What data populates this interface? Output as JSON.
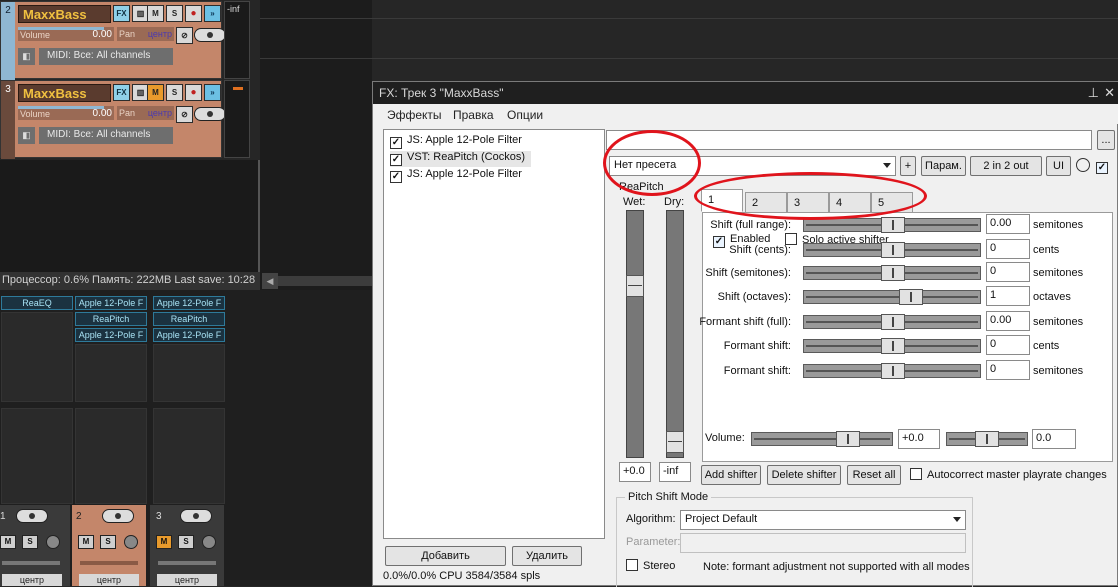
{
  "tracks": [
    {
      "num": "2",
      "name": "MaxxBass",
      "volume_label": "Volume",
      "volume_value": "0.00",
      "pan_label": "Pan",
      "pan_value": "центр",
      "midi": "MIDI: Все: All channels",
      "meter": "-inf",
      "fx": "FX",
      "m": "M",
      "s": "S"
    },
    {
      "num": "3",
      "name": "MaxxBass",
      "volume_label": "Volume",
      "volume_value": "0.00",
      "pan_label": "Pan",
      "pan_value": "центр",
      "midi": "MIDI: Все: All channels",
      "meter": "",
      "fx": "FX",
      "m": "M",
      "s": "S"
    }
  ],
  "status": {
    "text": "Процессор: 0.6%  Память: 222MB  Last save: 10:28"
  },
  "mixer": {
    "columns": [
      {
        "fx": [
          "ReaEQ"
        ],
        "num": "1",
        "pan": "центр"
      },
      {
        "fx": [
          "Apple 12-Pole F",
          "ReaPitch",
          "Apple 12-Pole F"
        ],
        "num": "2",
        "pan": "центр"
      },
      {
        "fx": [
          "Apple 12-Pole F",
          "ReaPitch",
          "Apple 12-Pole F"
        ],
        "num": "3",
        "pan": "центр"
      }
    ],
    "m": "M",
    "s": "S"
  },
  "fxwindow": {
    "title": "FX: Трек 3 \"MaxxBass\"",
    "menu": [
      "Эффекты",
      "Правка",
      "Опции"
    ],
    "chain": [
      {
        "label": "JS: Apple 12-Pole Filter",
        "checked": true
      },
      {
        "label": "VST: ReaPitch (Cockos)",
        "checked": true
      },
      {
        "label": "JS: Apple 12-Pole Filter",
        "checked": true
      }
    ],
    "add_button": "Добавить",
    "remove_button": "Удалить",
    "cpu": "0.0%/0.0% CPU 3584/3584 spls",
    "browse_button": "...",
    "preset": "Нет пресета",
    "plus_button": "+",
    "param_button": "Парам.",
    "io_button": "2 in 2 out",
    "ui_button": "UI",
    "plugin_name": "ReaPitch",
    "wet_label": "Wet:",
    "dry_label": "Dry:",
    "wet_value": "+0.0",
    "dry_value": "-inf",
    "tabs": [
      "1",
      "2",
      "3",
      "4",
      "5"
    ],
    "enabled_label": "Enabled",
    "solo_label": "Solo active shifter",
    "params": [
      {
        "label": "Shift (full range):",
        "value": "0.00",
        "unit": "semitones",
        "pos": 0.5
      },
      {
        "label": "Shift (cents):",
        "value": "0",
        "unit": "cents",
        "pos": 0.5
      },
      {
        "label": "Shift (semitones):",
        "value": "0",
        "unit": "semitones",
        "pos": 0.5
      },
      {
        "label": "Shift (octaves):",
        "value": "1",
        "unit": "octaves",
        "pos": 0.6
      },
      {
        "label": "Formant shift (full):",
        "value": "0.00",
        "unit": "semitones",
        "pos": 0.5
      },
      {
        "label": "Formant shift:",
        "value": "0",
        "unit": "cents",
        "pos": 0.5
      },
      {
        "label": "Formant shift:",
        "value": "0",
        "unit": "semitones",
        "pos": 0.5
      }
    ],
    "volume_label": "Volume:",
    "volume_value": "+0.0",
    "pan_value": "0.0",
    "add_shifter": "Add shifter",
    "delete_shifter": "Delete shifter",
    "reset_all": "Reset all",
    "autocorrect": "Autocorrect master playrate changes",
    "mode_group": "Pitch Shift Mode",
    "algorithm_label": "Algorithm:",
    "algorithm_value": "Project Default",
    "parameter_label": "Parameter:",
    "stereo_label": "Stereo",
    "note": "Note: formant adjustment not supported with all modes"
  },
  "colors": {
    "track_bg": "#c4866a",
    "fx_slot": "#a8e2f4",
    "annotation": "#e0141c"
  }
}
